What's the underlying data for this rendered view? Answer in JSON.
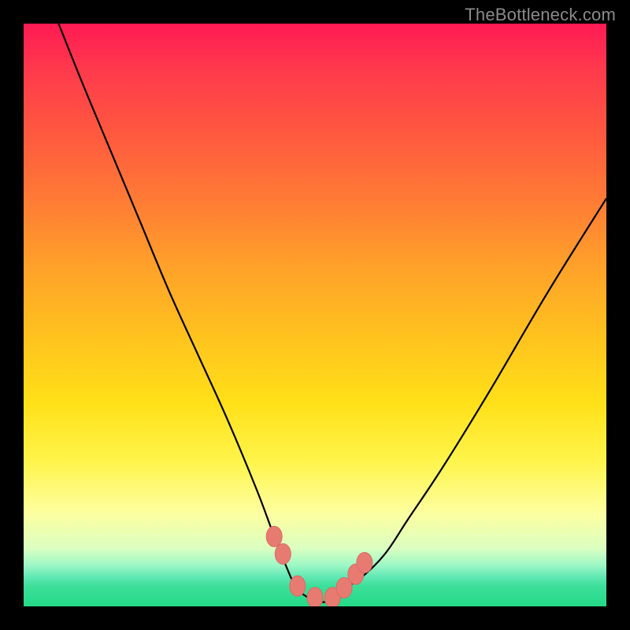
{
  "watermark": "TheBottleneck.com",
  "chart_data": {
    "type": "line",
    "title": "",
    "xlabel": "",
    "ylabel": "",
    "x_range": [
      0,
      100
    ],
    "y_range": [
      0,
      100
    ],
    "series": [
      {
        "name": "bottleneck-curve",
        "x": [
          6,
          10,
          15,
          20,
          25,
          30,
          35,
          40,
          43,
          45,
          47,
          50,
          53,
          55,
          58,
          62,
          66,
          72,
          80,
          90,
          100
        ],
        "y": [
          100,
          90,
          78,
          66,
          54,
          43,
          32,
          20,
          12,
          7,
          3,
          1,
          1,
          3,
          5,
          9,
          15,
          24,
          37,
          54,
          70
        ]
      }
    ],
    "markers": {
      "name": "highlight-points",
      "x": [
        43,
        44.5,
        47,
        50,
        53,
        55,
        57,
        58.5
      ],
      "y": [
        12,
        9,
        3.5,
        1.5,
        1.5,
        3.2,
        5.5,
        7.5
      ]
    },
    "marker_style": {
      "fill": "#e77b72",
      "stroke": "#d86a62",
      "rx": 10,
      "ry": 13
    },
    "curve_style": {
      "stroke": "#000000",
      "width": 2.2
    },
    "colors": {
      "frame": "#000000",
      "gradient_top": "#ff1a53",
      "gradient_bottom": "#24da88"
    }
  }
}
